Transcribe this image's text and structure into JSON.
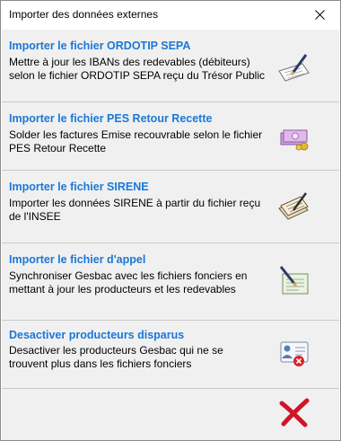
{
  "window": {
    "title": "Importer des données externes"
  },
  "items": [
    {
      "title": "Importer le fichier ORDOTIP SEPA",
      "description": "Mettre à jour les IBANs des redevables (débiteurs) selon le fichier ORDOTIP SEPA reçu du Trésor Public",
      "icon": "notepad-pen-icon"
    },
    {
      "title": "Importer le fichier PES Retour Recette",
      "description": "Solder les factures Emise recouvrable selon le fichier PES Retour Recette",
      "icon": "banknotes-icon"
    },
    {
      "title": "Importer le fichier SIRENE",
      "description": "Importer les données SIRENE à partir du fichier reçu de l'INSEE",
      "icon": "document-stack-icon"
    },
    {
      "title": "Importer le fichier d'appel",
      "description": "Synchroniser Gesbac avec les fichiers fonciers en mettant à jour les producteurs et les redevables",
      "icon": "document-pen-icon"
    },
    {
      "title": "Desactiver producteurs disparus",
      "description": "Desactiver les producteurs Gesbac qui ne se trouvent plus dans les fichiers fonciers",
      "icon": "user-card-remove-icon"
    }
  ],
  "cancel": {
    "icon": "red-x-icon"
  },
  "colors": {
    "link": "#1b78d6",
    "panel": "#f0f0f0",
    "separator": "#c9c9c9",
    "cancel": "#d0142a"
  }
}
